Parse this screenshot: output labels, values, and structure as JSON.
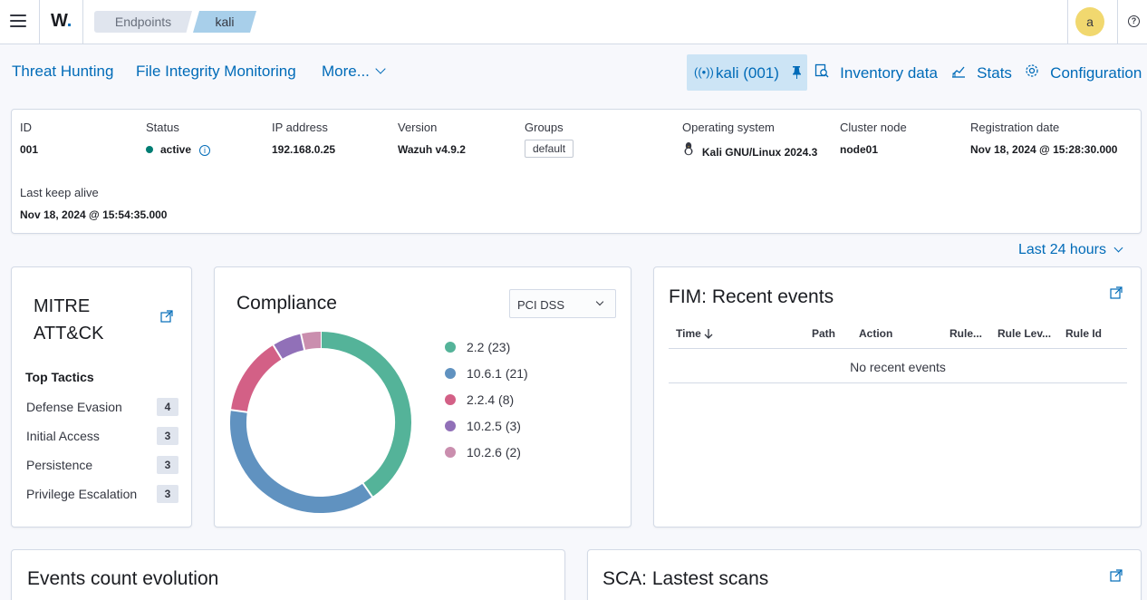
{
  "header": {
    "logo": "W",
    "logo_dot": ".",
    "breadcrumbs": [
      "Endpoints",
      "kali"
    ],
    "avatar": "a",
    "help": "?"
  },
  "nav": {
    "threat_hunting": "Threat Hunting",
    "fim": "File Integrity Monitoring",
    "more": "More...",
    "agent_pill": "kali (001)",
    "inventory": "Inventory data",
    "stats": "Stats",
    "configuration": "Configuration"
  },
  "agent": {
    "id_label": "ID",
    "id": "001",
    "status_label": "Status",
    "status": "active",
    "ip_label": "IP address",
    "ip": "192.168.0.25",
    "version_label": "Version",
    "version": "Wazuh v4.9.2",
    "groups_label": "Groups",
    "group": "default",
    "os_label": "Operating system",
    "os": "Kali GNU/Linux 2024.3",
    "cluster_label": "Cluster node",
    "cluster": "node01",
    "reg_label": "Registration date",
    "reg": "Nov 18, 2024 @ 15:28:30.000",
    "keepalive_label": "Last keep alive",
    "keepalive": "Nov 18, 2024 @ 15:54:35.000"
  },
  "timepicker": "Last 24 hours",
  "mitre": {
    "title": "MITRE ATT&CK",
    "subtitle": "Top Tactics",
    "tactics": [
      {
        "name": "Defense Evasion",
        "count": "4"
      },
      {
        "name": "Initial Access",
        "count": "3"
      },
      {
        "name": "Persistence",
        "count": "3"
      },
      {
        "name": "Privilege Escalation",
        "count": "3"
      }
    ]
  },
  "compliance": {
    "title": "Compliance",
    "selected": "PCI DSS",
    "legend": [
      "2.2 (23)",
      "10.6.1 (21)",
      "2.2.4 (8)",
      "10.2.5 (3)",
      "10.2.6 (2)"
    ],
    "colors": [
      "#54b399",
      "#6092c0",
      "#d36086",
      "#9170b8",
      "#ca8eae"
    ]
  },
  "chart_data": {
    "type": "pie",
    "categories": [
      "2.2",
      "10.6.1",
      "2.2.4",
      "10.2.5",
      "10.2.6"
    ],
    "values": [
      23,
      21,
      8,
      3,
      2
    ],
    "title": "",
    "legend": "right"
  },
  "fim": {
    "title": "FIM: Recent events",
    "columns": [
      "Time",
      "Path",
      "Action",
      "Rule...",
      "Rule Lev...",
      "Rule Id"
    ],
    "empty": "No recent events"
  },
  "events": {
    "title": "Events count evolution"
  },
  "sca": {
    "title": "SCA: Lastest scans"
  }
}
